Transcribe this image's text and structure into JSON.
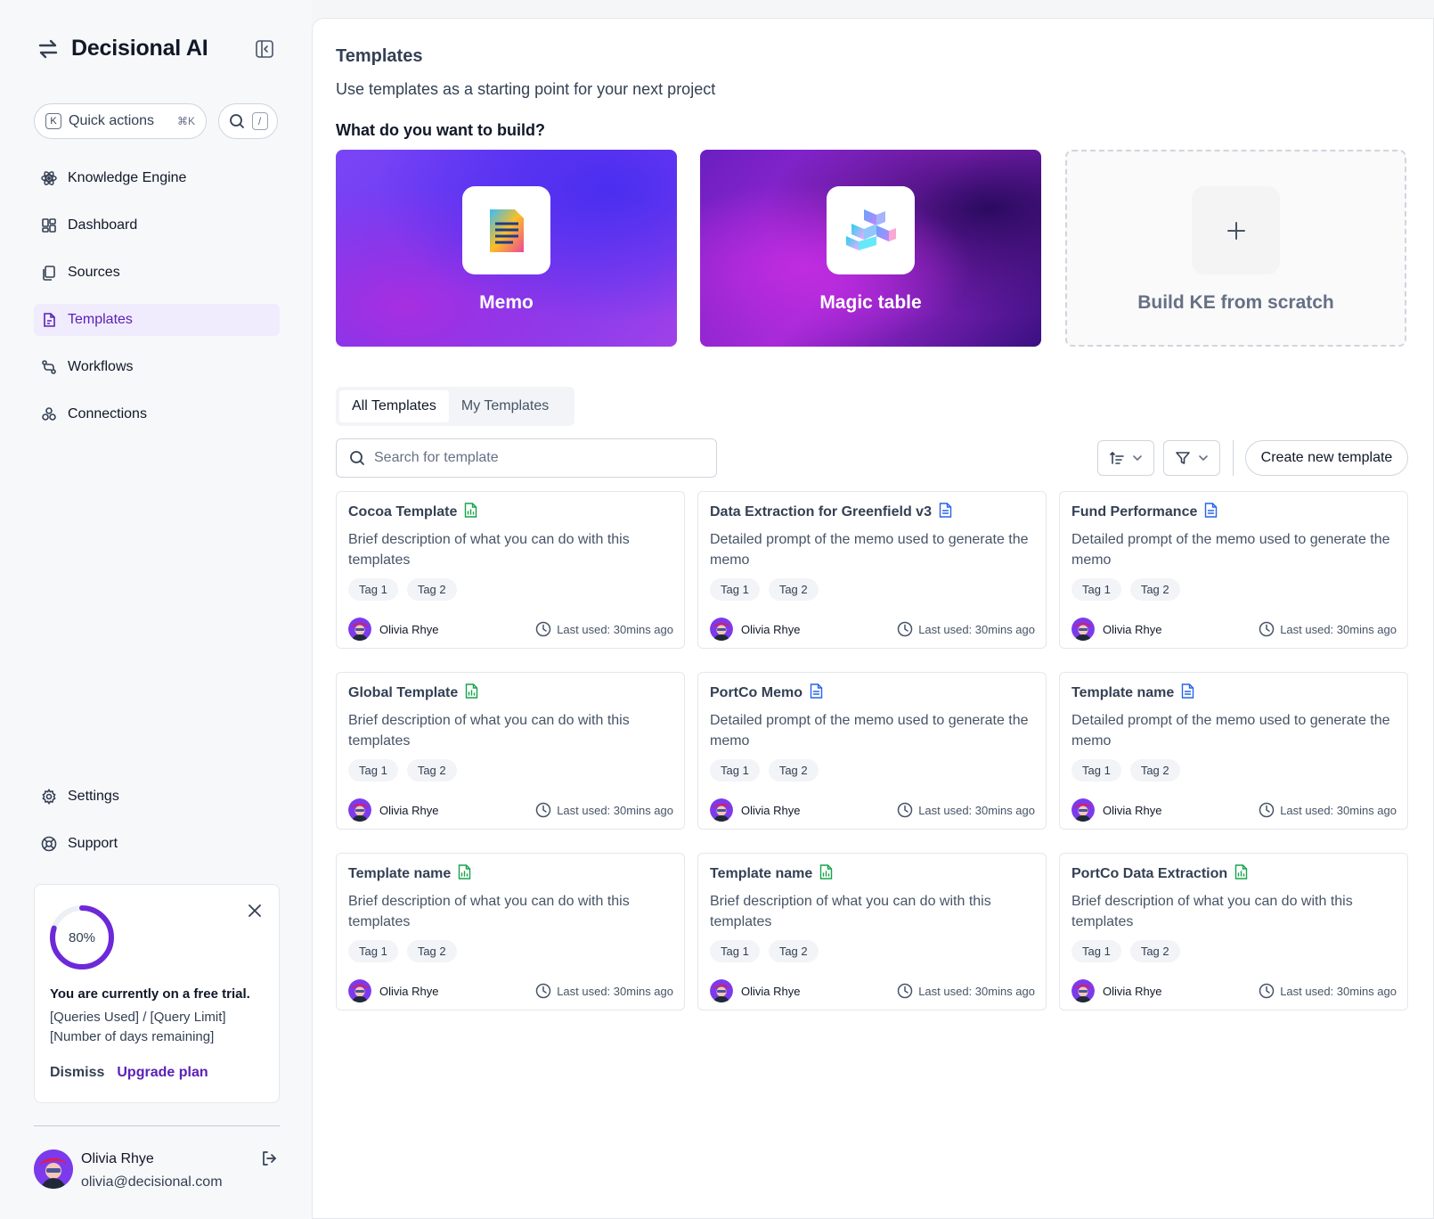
{
  "sidebar": {
    "brand": "Decisional AI",
    "quick_actions_label": "Quick actions",
    "quick_actions_kbd": "K",
    "quick_actions_shortcut": "⌘K",
    "search_kbd": "/",
    "nav": [
      {
        "label": "Knowledge Engine",
        "icon": "atom-icon"
      },
      {
        "label": "Dashboard",
        "icon": "grid-icon"
      },
      {
        "label": "Sources",
        "icon": "files-icon"
      },
      {
        "label": "Templates",
        "icon": "template-icon",
        "active": true
      },
      {
        "label": "Workflows",
        "icon": "workflow-icon"
      },
      {
        "label": "Connections",
        "icon": "connections-icon"
      }
    ],
    "nav_bottom": [
      {
        "label": "Settings",
        "icon": "gear-icon"
      },
      {
        "label": "Support",
        "icon": "lifebuoy-icon"
      }
    ],
    "trial": {
      "progress_label": "80%",
      "progress": 0.8,
      "title": "You are currently on a free trial.",
      "line1": "[Queries Used] / [Query Limit]",
      "line2": "[Number of days remaining]",
      "dismiss": "Dismiss",
      "upgrade": "Upgrade plan"
    },
    "user": {
      "name": "Olivia Rhye",
      "email": "olivia@decisional.com"
    }
  },
  "main": {
    "title": "Templates",
    "subtitle": "Use templates as a starting point for your next project",
    "build_question": "What do you want to build?",
    "hero": [
      {
        "label": "Memo"
      },
      {
        "label": "Magic table"
      },
      {
        "label": "Build KE from scratch"
      }
    ],
    "tabs": [
      "All Templates",
      "My Templates"
    ],
    "search_placeholder": "Search for template",
    "create_label": "Create new template",
    "cards": [
      {
        "title": "Cocoa Template",
        "icon": "sheet",
        "desc": "Brief description of what you can do with this templates",
        "tags": [
          "Tag 1",
          "Tag 2"
        ],
        "owner": "Olivia Rhye",
        "last": "Last used: 30mins ago"
      },
      {
        "title": "Data Extraction for Greenfield v3",
        "icon": "doc",
        "desc": "Detailed prompt of the memo used to generate the memo",
        "tags": [
          "Tag 1",
          "Tag 2"
        ],
        "owner": "Olivia Rhye",
        "last": "Last used: 30mins ago"
      },
      {
        "title": "Fund Performance",
        "icon": "doc",
        "desc": "Detailed prompt of the memo used to generate the memo",
        "tags": [
          "Tag 1",
          "Tag 2"
        ],
        "owner": "Olivia Rhye",
        "last": "Last used: 30mins ago"
      },
      {
        "title": "Global Template",
        "icon": "sheet",
        "desc": "Brief description of what you can do with this templates",
        "tags": [
          "Tag 1",
          "Tag 2"
        ],
        "owner": "Olivia Rhye",
        "last": "Last used: 30mins ago"
      },
      {
        "title": "PortCo Memo",
        "icon": "doc",
        "desc": "Detailed prompt of the memo used to generate the memo",
        "tags": [
          "Tag 1",
          "Tag 2"
        ],
        "owner": "Olivia Rhye",
        "last": "Last used: 30mins ago"
      },
      {
        "title": "Template name",
        "icon": "doc",
        "desc": "Detailed prompt of the memo used to generate the memo",
        "tags": [
          "Tag 1",
          "Tag 2"
        ],
        "owner": "Olivia Rhye",
        "last": "Last used: 30mins ago"
      },
      {
        "title": "Template name",
        "icon": "sheet",
        "desc": "Brief description of what you can do with this templates",
        "tags": [
          "Tag 1",
          "Tag 2"
        ],
        "owner": "Olivia Rhye",
        "last": "Last used: 30mins ago"
      },
      {
        "title": "Template name",
        "icon": "sheet",
        "desc": "Brief description of what you can do with this templates",
        "tags": [
          "Tag 1",
          "Tag 2"
        ],
        "owner": "Olivia Rhye",
        "last": "Last used: 30mins ago"
      },
      {
        "title": "PortCo Data Extraction",
        "icon": "sheet",
        "desc": "Brief description of what you can do with this templates",
        "tags": [
          "Tag 1",
          "Tag 2"
        ],
        "owner": "Olivia Rhye",
        "last": "Last used: 30mins ago"
      }
    ]
  },
  "colors": {
    "accent": "#5b21b6",
    "sheet_icon": "#16a34a",
    "doc_icon": "#2563eb"
  }
}
